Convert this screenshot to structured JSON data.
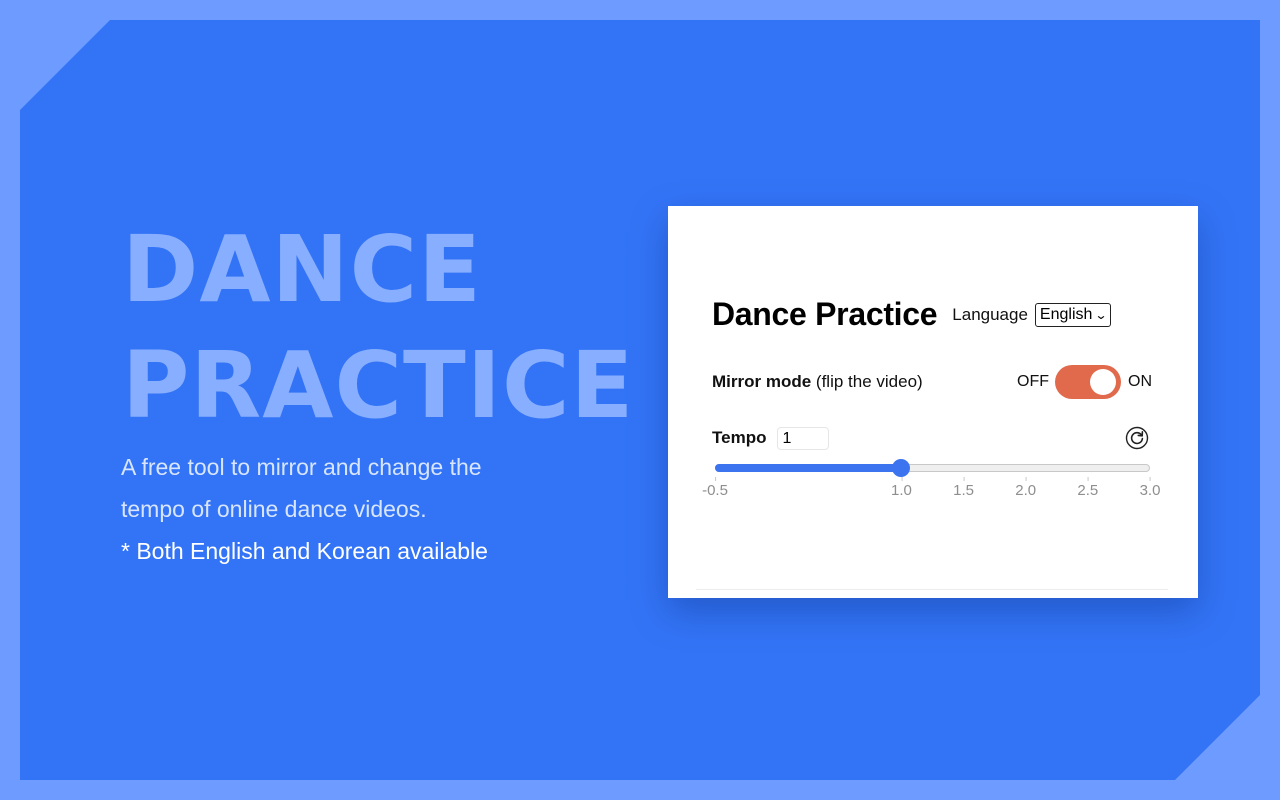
{
  "hero": {
    "title_line1": "DANCE",
    "title_line2": "PRACTICE",
    "desc_line1": "A free tool to mirror and change the",
    "desc_line2": "tempo of online dance videos.",
    "note": "* Both English and Korean available"
  },
  "app": {
    "title": "Dance Practice",
    "language_label": "Language",
    "language_selected": "English",
    "mirror_label_bold": "Mirror mode",
    "mirror_label_hint": "(flip the video)",
    "toggle_off_label": "OFF",
    "toggle_on_label": "ON",
    "mirror_enabled": true,
    "tempo_label": "Tempo",
    "tempo_value": "1",
    "reset_icon": "refresh-icon",
    "slider": {
      "min": -0.5,
      "max": 3.0,
      "value": 1.0,
      "ticks": [
        "-0.5",
        "1.0",
        "1.5",
        "2.0",
        "2.5",
        "3.0"
      ]
    }
  },
  "colors": {
    "page_bg": "#6d9bff",
    "panel_bg": "#3374f6",
    "hero_title": "#88aeff",
    "toggle_active": "#e06a4b",
    "slider_accent": "#3b74ee"
  }
}
